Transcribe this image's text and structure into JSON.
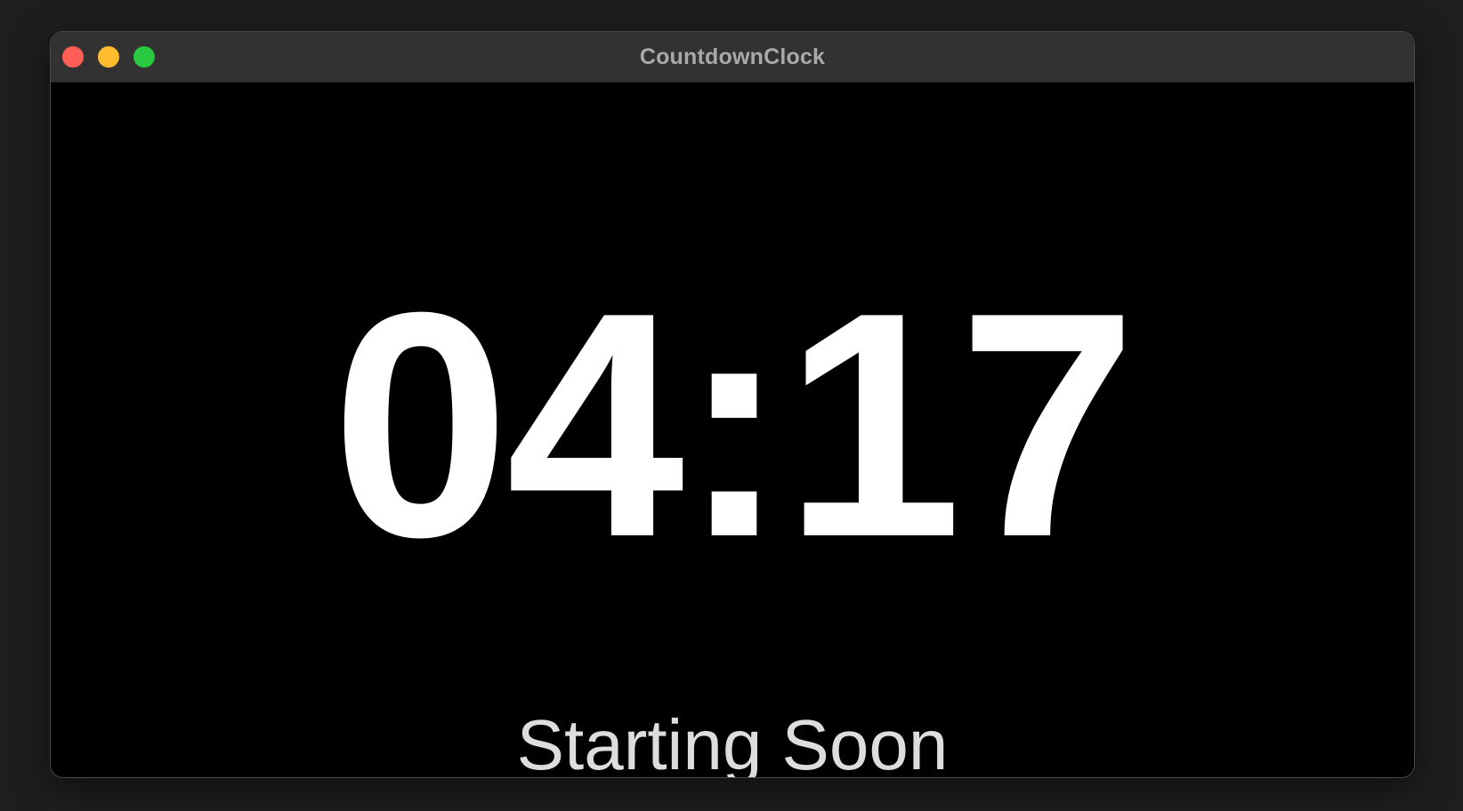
{
  "window": {
    "title": "CountdownClock",
    "controls": {
      "close_color": "#ff5f57",
      "minimize_color": "#febc2e",
      "zoom_color": "#28c840"
    }
  },
  "timer": {
    "display": "04:17",
    "minutes": 4,
    "seconds": 17,
    "color": "#ffffff"
  },
  "status": {
    "label": "Starting Soon",
    "color": "#dddddd"
  },
  "colors": {
    "background": "#000000",
    "titlebar": "#323232",
    "desktop": "#1e1e1e"
  }
}
